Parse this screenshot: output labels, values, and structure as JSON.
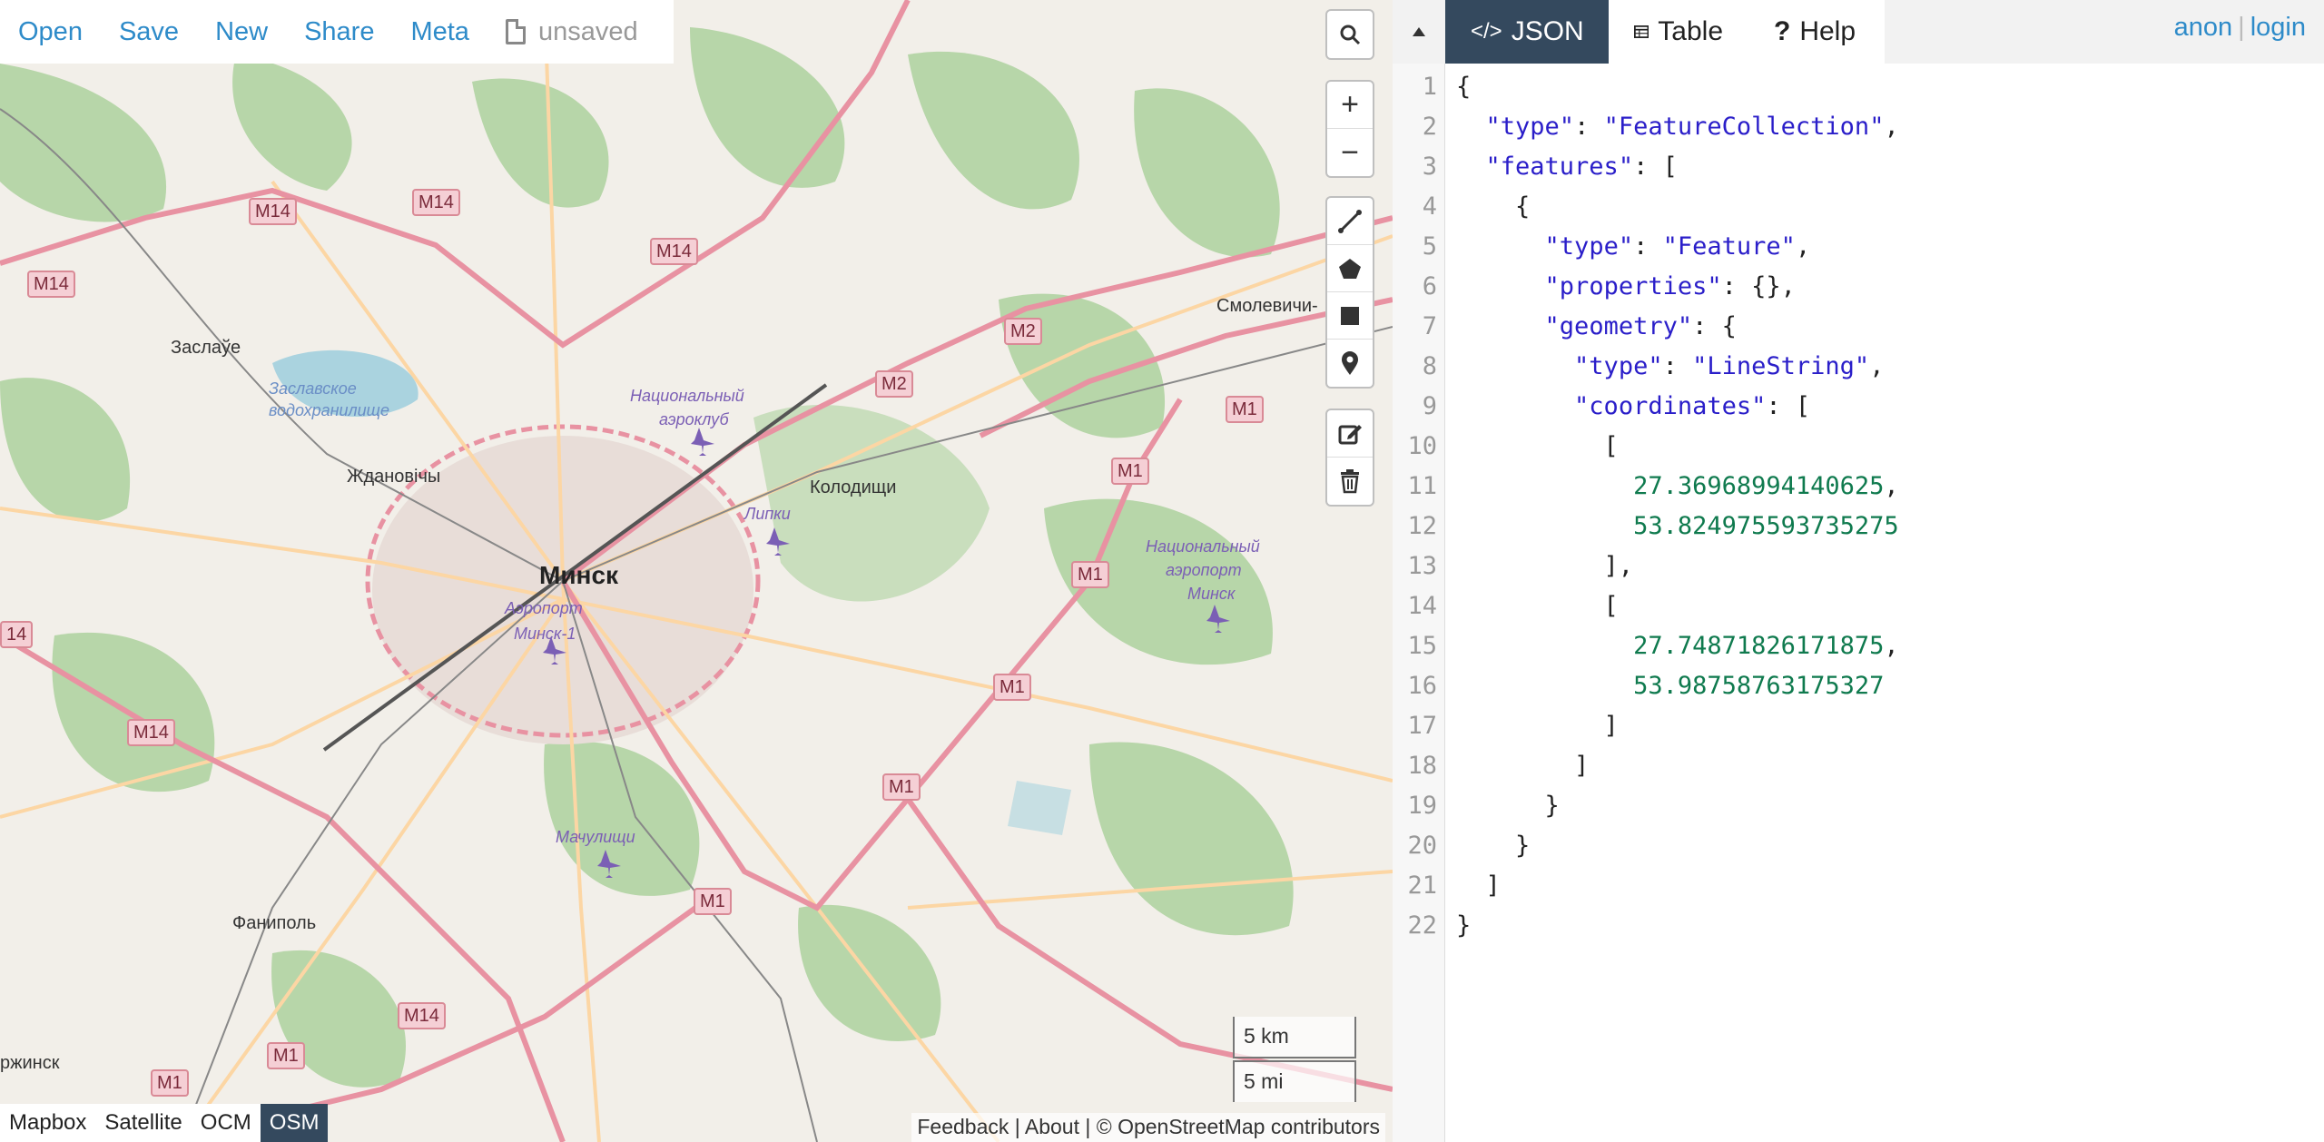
{
  "toolbar": {
    "open": "Open",
    "save": "Save",
    "new": "New",
    "share": "Share",
    "meta": "Meta",
    "status": "unsaved"
  },
  "map": {
    "places": {
      "minsk": "Минск",
      "zaslavl": "Заслаўе",
      "zhdanovichy": "Ждановічы",
      "kolodishchi": "Колодищи",
      "smolevichi": "Смолевичи-",
      "fanipol": "Фаниполь",
      "dzerzhinsk": "ржинск",
      "reservoir_1": "Заславское",
      "reservoir_2": "водохранилище",
      "lipki": "Липки",
      "machulishchi": "Мачулищи",
      "aeroclub_1": "Национальный",
      "aeroclub_2": "аэроклуб",
      "airport1_1": "Аэропорт",
      "airport1_2": "Минск-1",
      "airport2_1": "Национальный",
      "airport2_2": "аэропорт",
      "airport2_3": "Минск"
    },
    "shields": [
      "M14",
      "M14",
      "M14",
      "M14",
      "M14",
      "M14",
      "M14",
      "M2",
      "M2",
      "M1",
      "M1",
      "M1",
      "M1",
      "M1",
      "M1",
      "M1",
      "M1",
      "14"
    ],
    "scale_km": "5 km",
    "scale_mi": "5 mi",
    "layers": [
      "Mapbox",
      "Satellite",
      "OCM",
      "OSM"
    ],
    "active_layer": "OSM",
    "attribution": "Feedback | About | © OpenStreetMap contributors"
  },
  "panel": {
    "tabs": {
      "json": "JSON",
      "table": "Table",
      "help": "Help"
    },
    "user": {
      "anon": "anon",
      "login": "login"
    }
  },
  "editor": {
    "lines": [
      "{",
      "  \"type\": \"FeatureCollection\",",
      "  \"features\": [",
      "    {",
      "      \"type\": \"Feature\",",
      "      \"properties\": {},",
      "      \"geometry\": {",
      "        \"type\": \"LineString\",",
      "        \"coordinates\": [",
      "          [",
      "            27.36968994140625,",
      "            53.824975593735275",
      "          ],",
      "          [",
      "            27.74871826171875,",
      "            53.98758763175327",
      "          ]",
      "        ]",
      "      }",
      "    }",
      "  ]",
      "}"
    ]
  },
  "colors": {
    "link": "#2e8bc9",
    "tab_active": "#34495e",
    "motorway": "#e892a2",
    "primary": "#fcd6a4",
    "forest": "#add19e"
  }
}
